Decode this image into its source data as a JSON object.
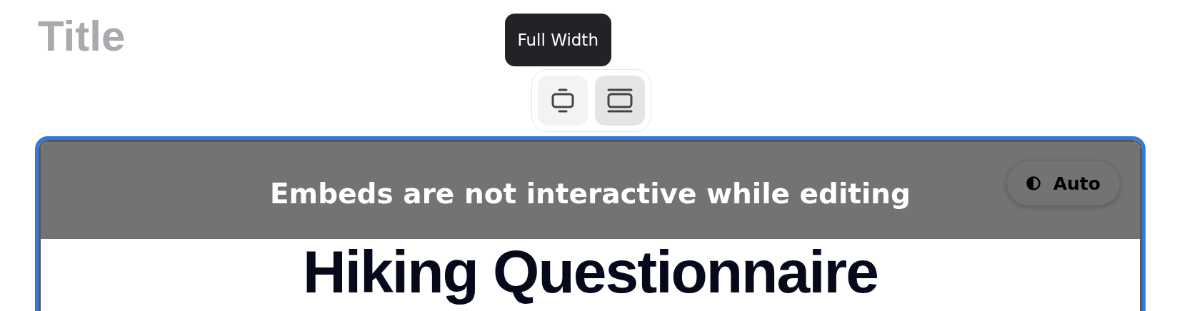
{
  "title": {
    "placeholder": "Title"
  },
  "tooltip": "Full Width",
  "width_options": [
    {
      "kind": "centered",
      "selected": false
    },
    {
      "kind": "full",
      "selected": true
    }
  ],
  "embed": {
    "notice": "Embeds are not interactive while editing",
    "theme_button": "Auto",
    "heading": "Hiking Questionnaire"
  }
}
